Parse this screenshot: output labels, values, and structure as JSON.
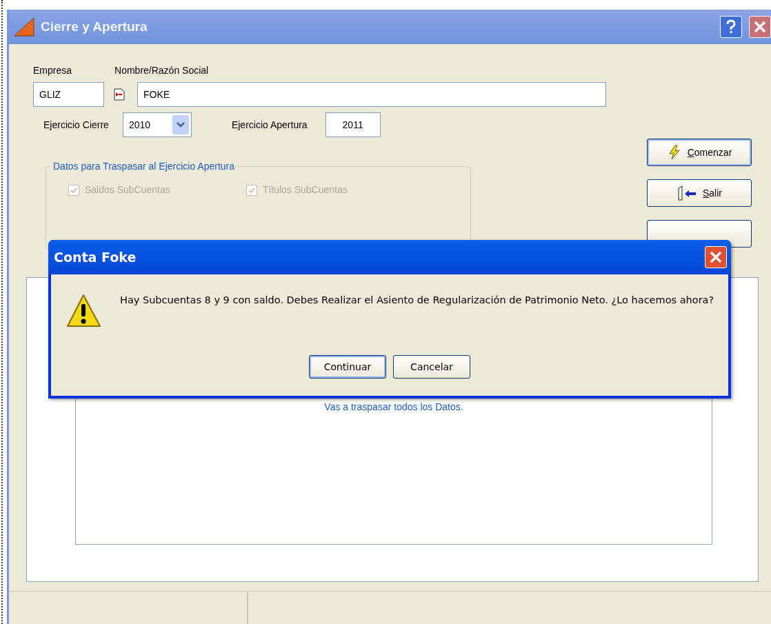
{
  "window": {
    "title": "Cierre y Apertura"
  },
  "fields": [
    {
      "label": "Empresa",
      "value": "GLIZ"
    },
    {
      "label": "Nombre/Razón Social",
      "value": "FOKE"
    },
    {
      "label": "Ejercicio Cierre",
      "value": "2010"
    },
    {
      "label": "Ejercicio Apertura",
      "value": "2011"
    }
  ],
  "group": {
    "title": "Datos para Traspasar al Ejercicio Apertura",
    "options": [
      {
        "label": "Saldos SubCuentas",
        "checked": true,
        "disabled": true
      },
      {
        "label": "Títulos SubCuentas",
        "checked": true,
        "disabled": true
      }
    ]
  },
  "buttons": [
    {
      "label": "Comenzar",
      "kind": "start",
      "default": true
    },
    {
      "label": "Salir",
      "kind": "exit",
      "default": false
    },
    {
      "kind": "covered",
      "default": false
    }
  ],
  "message_panel": {
    "text": "Vas a traspasar todos los Datos."
  },
  "dialog": {
    "title": "Conta Foke",
    "message": "Hay Subcuentas 8 y 9 con saldo. Debes Realizar el Asiento de Regularización de Patrimonio Neto. ¿Lo hacemos ahora?",
    "buttons": [
      {
        "label": "Continuar",
        "default": true
      },
      {
        "label": "Cancelar",
        "default": false
      }
    ]
  }
}
